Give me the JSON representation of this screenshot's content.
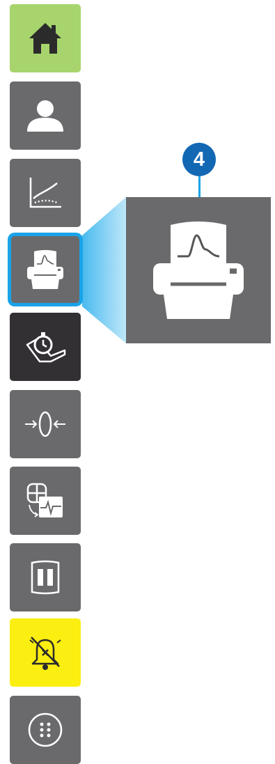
{
  "sidebar": {
    "buttons": [
      {
        "name": "home",
        "icon": "home-icon",
        "bg": "#a7d46c"
      },
      {
        "name": "patient",
        "icon": "person-icon",
        "bg": "#6a6a6d"
      },
      {
        "name": "trends",
        "icon": "trend-graph-icon",
        "bg": "#6a6a6d"
      },
      {
        "name": "print-report",
        "icon": "printer-waveform-icon",
        "bg": "#6a6a6d",
        "state": "selected"
      },
      {
        "name": "timed-measurement",
        "icon": "stopwatch-hand-icon",
        "bg": "#333034"
      },
      {
        "name": "zero",
        "icon": "zero-arrows-icon",
        "bg": "#6a6a6d"
      },
      {
        "name": "monitor-network",
        "icon": "monitor-network-icon",
        "bg": "#6a6a6d"
      },
      {
        "name": "pause",
        "icon": "pause-icon",
        "bg": "#6a6a6d"
      },
      {
        "name": "alarm-silence",
        "icon": "alarm-bell-muted-icon",
        "bg": "#fbee11"
      },
      {
        "name": "more-menu",
        "icon": "dots-grid-icon",
        "bg": "#6a6a6d"
      }
    ]
  },
  "callout": {
    "number": "4",
    "badge_color": "#1368b4",
    "highlight_color": "#1aa3e8",
    "zoom_icon": "printer-waveform-icon"
  }
}
